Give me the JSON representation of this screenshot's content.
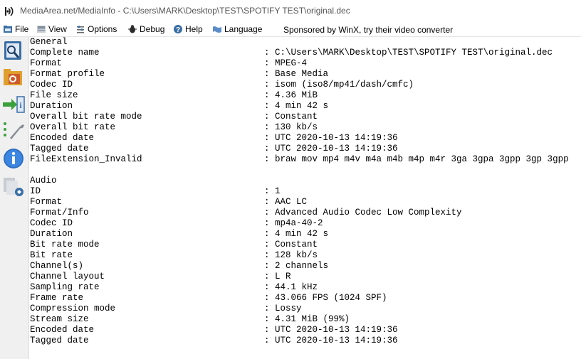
{
  "window": {
    "title": "MediaArea.net/MediaInfo - C:\\Users\\MARK\\Desktop\\TEST\\SPOTIFY TEST\\original.dec"
  },
  "menu": {
    "items": [
      {
        "label": "File",
        "icon": "file-icon"
      },
      {
        "label": "View",
        "icon": "view-icon"
      },
      {
        "label": "Options",
        "icon": "options-icon"
      },
      {
        "label": "Debug",
        "icon": "debug-icon"
      },
      {
        "label": "Help",
        "icon": "help-icon"
      },
      {
        "label": "Language",
        "icon": "language-icon"
      }
    ],
    "sponsor": "Sponsored by WinX, try their video converter"
  },
  "toolbar": {
    "buttons": [
      "open-file-icon",
      "open-folder-icon",
      "export-icon",
      "preferences-icon",
      "about-icon",
      "view-options-icon"
    ]
  },
  "report": {
    "separator": ":",
    "lines": [
      {
        "key": "General"
      },
      {
        "key": "Complete name",
        "value": "C:\\Users\\MARK\\Desktop\\TEST\\SPOTIFY TEST\\original.dec"
      },
      {
        "key": "Format",
        "value": "MPEG-4"
      },
      {
        "key": "Format profile",
        "value": "Base Media"
      },
      {
        "key": "Codec ID",
        "value": "isom (iso8/mp41/dash/cmfc)"
      },
      {
        "key": "File size",
        "value": "4.36 MiB"
      },
      {
        "key": "Duration",
        "value": "4 min 42 s"
      },
      {
        "key": "Overall bit rate mode",
        "value": "Constant"
      },
      {
        "key": "Overall bit rate",
        "value": "130 kb/s"
      },
      {
        "key": "Encoded date",
        "value": "UTC 2020-10-13 14:19:36"
      },
      {
        "key": "Tagged date",
        "value": "UTC 2020-10-13 14:19:36"
      },
      {
        "key": "FileExtension_Invalid",
        "value": "braw mov mp4 m4v m4a m4b m4p m4r 3ga 3gpa 3gpp 3gp 3gpp"
      },
      {
        "key": ""
      },
      {
        "key": "Audio"
      },
      {
        "key": "ID",
        "value": "1"
      },
      {
        "key": "Format",
        "value": "AAC LC"
      },
      {
        "key": "Format/Info",
        "value": "Advanced Audio Codec Low Complexity"
      },
      {
        "key": "Codec ID",
        "value": "mp4a-40-2"
      },
      {
        "key": "Duration",
        "value": "4 min 42 s"
      },
      {
        "key": "Bit rate mode",
        "value": "Constant"
      },
      {
        "key": "Bit rate",
        "value": "128 kb/s"
      },
      {
        "key": "Channel(s)",
        "value": "2 channels"
      },
      {
        "key": "Channel layout",
        "value": "L R"
      },
      {
        "key": "Sampling rate",
        "value": "44.1 kHz"
      },
      {
        "key": "Frame rate",
        "value": "43.066 FPS (1024 SPF)"
      },
      {
        "key": "Compression mode",
        "value": "Lossy"
      },
      {
        "key": "Stream size",
        "value": "4.31 MiB (99%)"
      },
      {
        "key": "Encoded date",
        "value": "UTC 2020-10-13 14:19:36"
      },
      {
        "key": "Tagged date",
        "value": "UTC 2020-10-13 14:19:36"
      }
    ]
  }
}
